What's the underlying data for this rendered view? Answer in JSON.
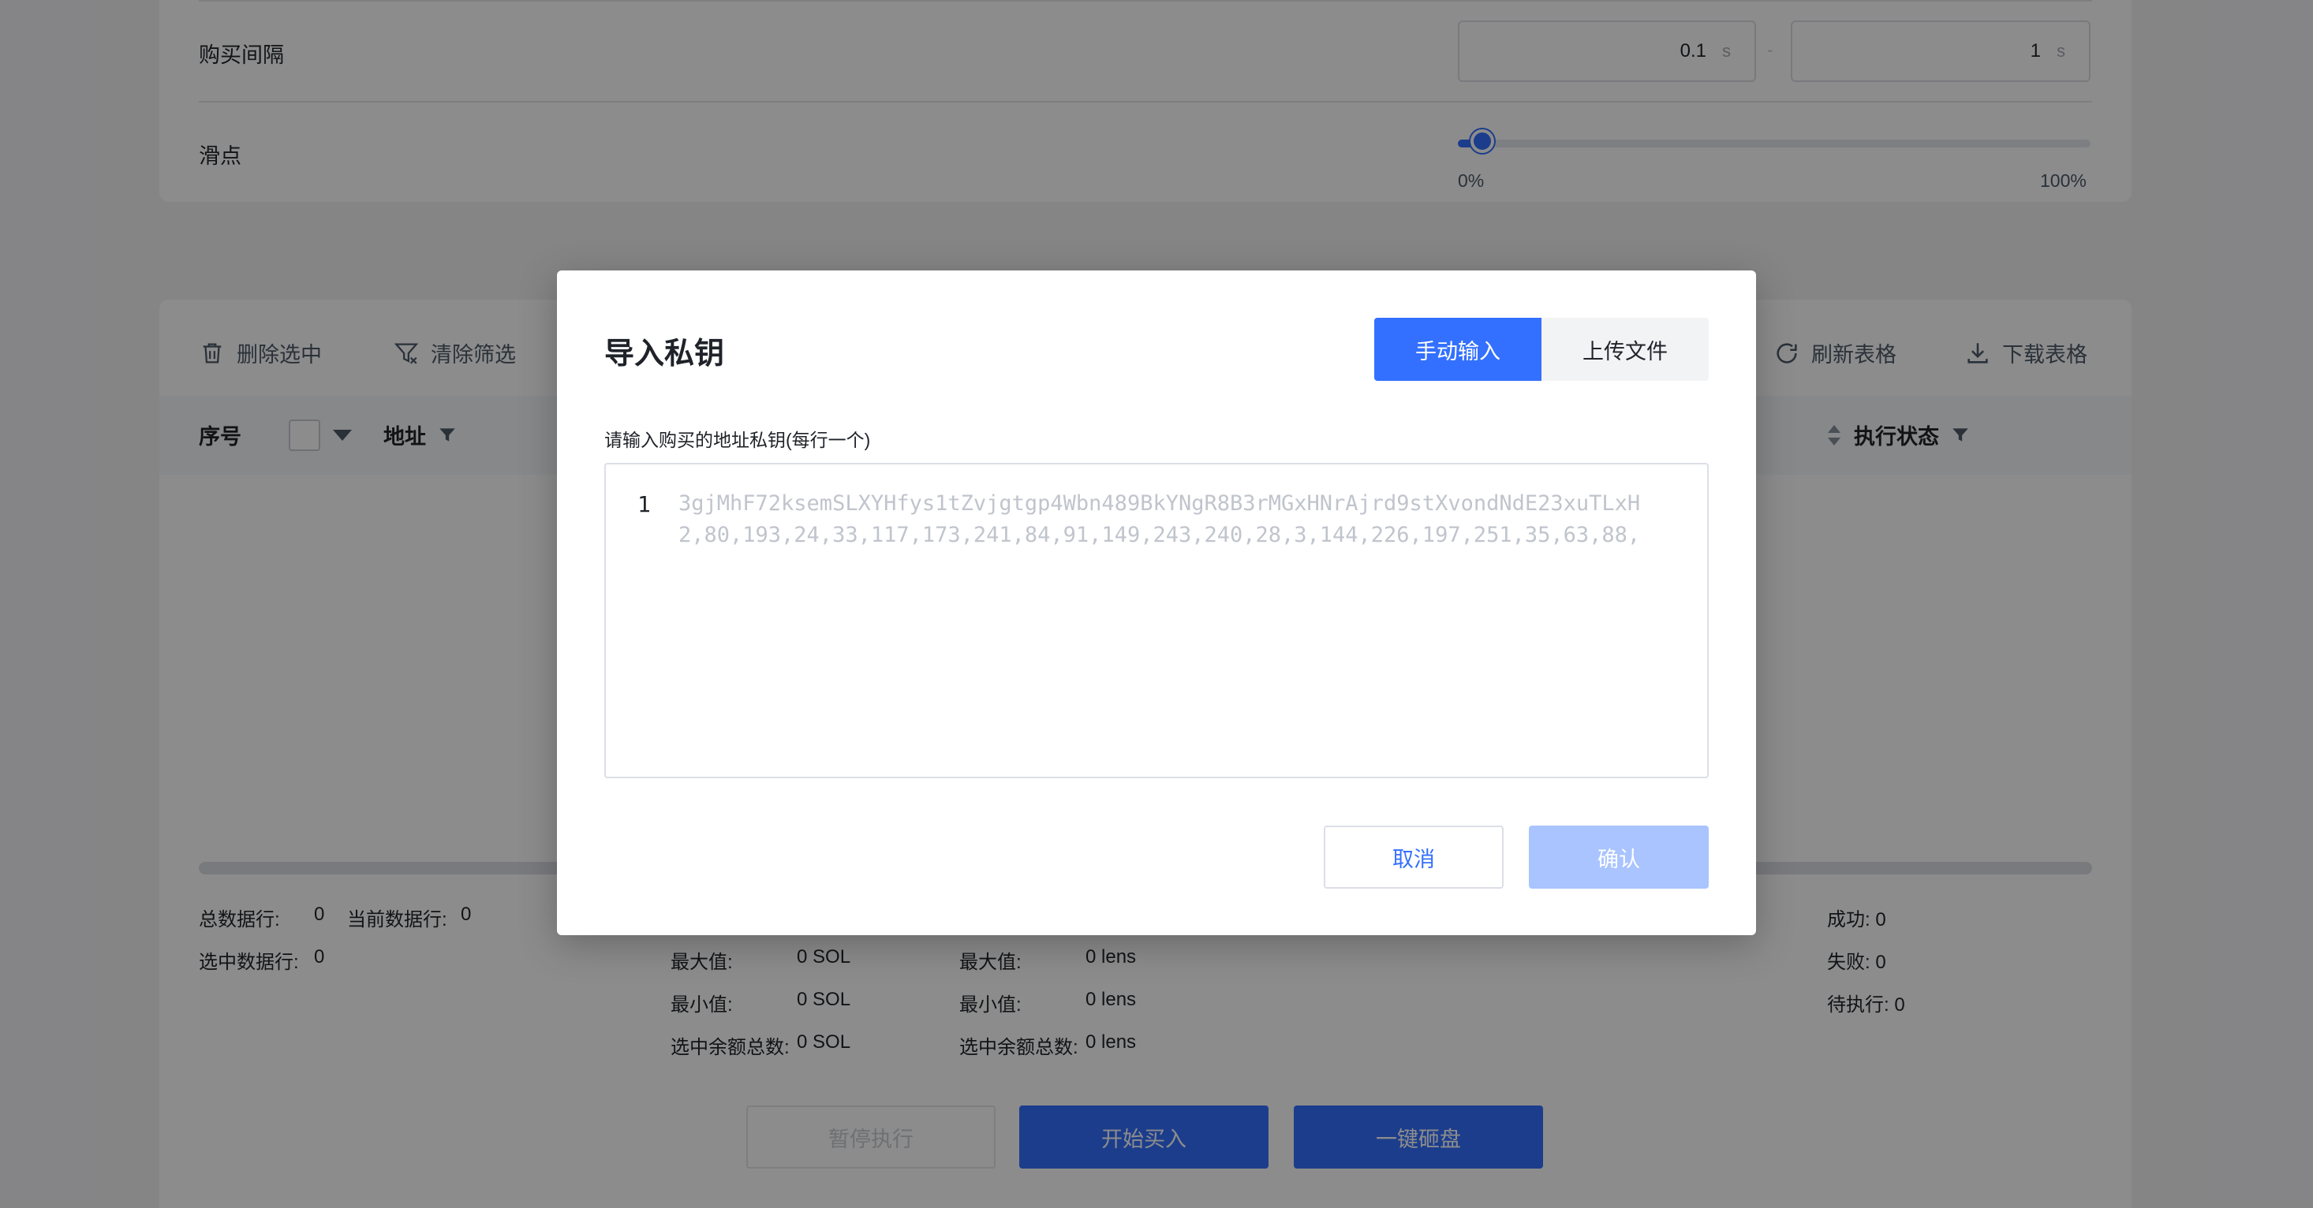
{
  "settings": {
    "interval_label": "购买间隔",
    "interval_min": "0.1",
    "interval_max": "1",
    "interval_unit": "s",
    "interval_sep": "-",
    "slippage_label": "滑点",
    "slippage_value_pct": 2,
    "slider_min_label": "0%",
    "slider_max_label": "100%"
  },
  "toolbar": {
    "delete_selected": "删除选中",
    "clear_filter": "清除筛选",
    "refresh_table": "刷新表格",
    "download_table": "下载表格"
  },
  "table": {
    "col_index": "序号",
    "col_address": "地址",
    "col_status": "执行状态"
  },
  "stats": {
    "total_rows_label": "总数据行:",
    "total_rows": "0",
    "current_rows_label": "当前数据行:",
    "current_rows": "0",
    "selected_rows_label": "选中数据行:",
    "selected_rows": "0",
    "sol": {
      "max_label": "最大值:",
      "max": "0 SOL",
      "min_label": "最小值:",
      "min": "0 SOL",
      "selected_total_label": "选中余额总数:",
      "selected_total": "0 SOL"
    },
    "lens": {
      "max_label": "最大值:",
      "max": "0 lens",
      "min_label": "最小值:",
      "min": "0 lens",
      "selected_total_label": "选中余额总数:",
      "selected_total": "0 lens"
    },
    "success": "成功: 0",
    "fail": "失败: 0",
    "pending": "待执行: 0"
  },
  "actions": {
    "pause": "暂停执行",
    "start_buy": "开始买入",
    "sell_all": "一键砸盘"
  },
  "modal": {
    "title": "导入私钥",
    "tab_manual": "手动输入",
    "tab_upload": "上传文件",
    "field_label": "请输入购买的地址私钥(每行一个)",
    "line_number": "1",
    "placeholder_line1": "3gjMhF72ksemSLXYHfys1tZvjgtgp4Wbn489BkYNgR8B3rMGxHNrAjrd9stXvondNdE23xuTLxH",
    "placeholder_line2": "2,80,193,24,33,117,173,241,84,91,149,243,240,28,3,144,226,197,251,35,63,88,",
    "cancel": "取消",
    "confirm": "确认"
  },
  "colors": {
    "primary": "#3370ff",
    "primary_disabled": "#a9c4ff",
    "dark_button": "#3370ff"
  }
}
